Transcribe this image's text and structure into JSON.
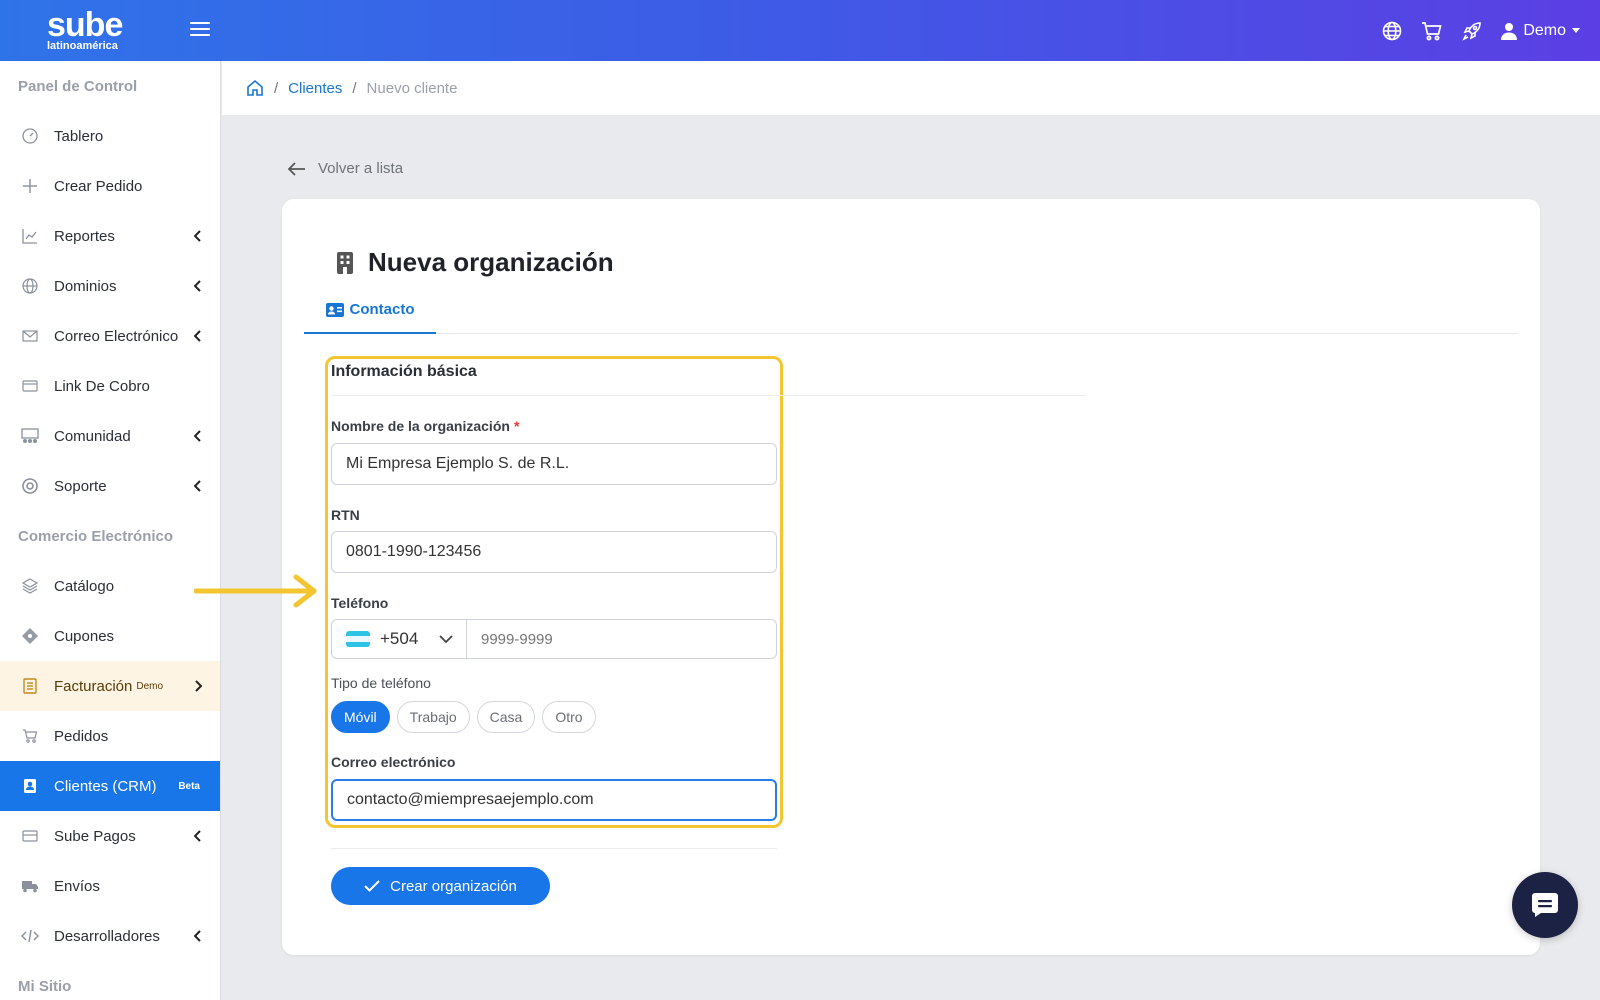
{
  "header": {
    "logo_brand": "sube",
    "logo_sub": "latinoamérica",
    "user_label": "Demo"
  },
  "sidebar": {
    "sections": [
      "Panel de Control",
      "Comercio Electrónico",
      "Mi Sitio"
    ],
    "items": [
      {
        "label": "Tablero",
        "icon": "dashboard-icon"
      },
      {
        "label": "Crear Pedido",
        "icon": "plus-icon"
      },
      {
        "label": "Reportes",
        "icon": "chart-icon"
      },
      {
        "label": "Dominios",
        "icon": "globe-icon"
      },
      {
        "label": "Correo Electrónico",
        "icon": "mail-icon"
      },
      {
        "label": "Link De Cobro",
        "icon": "card-icon"
      },
      {
        "label": "Comunidad",
        "icon": "community-icon"
      },
      {
        "label": "Soporte",
        "icon": "support-icon"
      },
      {
        "label": "Catálogo",
        "icon": "layers-icon"
      },
      {
        "label": "Cupones",
        "icon": "ticket-icon"
      },
      {
        "label": "Facturación",
        "icon": "invoice-icon",
        "sup": "Demo"
      },
      {
        "label": "Pedidos",
        "icon": "cart-icon"
      },
      {
        "label": "Clientes (CRM)",
        "icon": "contacts-icon",
        "badge": "Beta"
      },
      {
        "label": "Sube Pagos",
        "icon": "wallet-icon"
      },
      {
        "label": "Envíos",
        "icon": "truck-icon"
      },
      {
        "label": "Desarrolladores",
        "icon": "code-icon"
      }
    ]
  },
  "breadcrumb": {
    "link": "Clientes",
    "current": "Nuevo cliente"
  },
  "back_label": "Volver a lista",
  "card": {
    "title": "Nueva organización",
    "tab": "Contacto"
  },
  "form": {
    "section_title": "Información básica",
    "org_name_label": "Nombre de la organización",
    "org_name_value": "Mi Empresa Ejemplo S. de R.L.",
    "rtn_label": "RTN",
    "rtn_value": "0801-1990-123456",
    "phone_label": "Teléfono",
    "country_code": "+504",
    "phone_placeholder": "9999-9999",
    "phone_type_label": "Tipo de teléfono",
    "phone_types": [
      "Móvil",
      "Trabajo",
      "Casa",
      "Otro"
    ],
    "email_label": "Correo electrónico",
    "email_value": "contacto@miempresaejemplo.com",
    "submit_label": "Crear organización"
  },
  "colors": {
    "primary": "#1976e8",
    "highlight_frame": "#f2c531",
    "annotation_arrow": "#f2c531"
  }
}
